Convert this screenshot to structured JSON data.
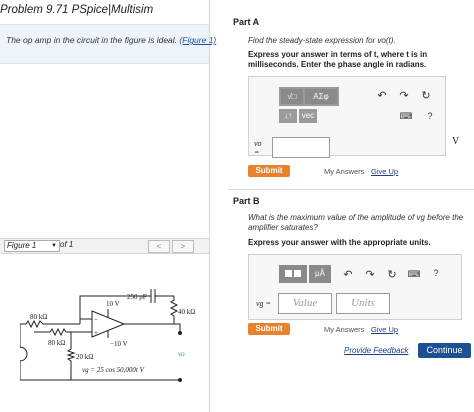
{
  "left": {
    "title": "Problem 9.71 PSpice|Multisim",
    "intro_text": "The op amp in the circuit in the figure is ideal.",
    "intro_link": "(Figure 1)",
    "figure_selector": "Figure 1",
    "figure_of": "of 1",
    "nav_prev": "<",
    "nav_next": ">"
  },
  "circuit": {
    "r1": "80 kΩ",
    "r2": "80 kΩ",
    "r3": "20 kΩ",
    "r4": "40 kΩ",
    "c1": "250 pF",
    "vpos": "10 V",
    "vneg": "−10 V",
    "minus": "−",
    "plus": "+",
    "vg": "vg",
    "vo": "vo",
    "src_plus": "+",
    "src_minus": "−",
    "vg_eq": "vg = 25 cos 50,000t V"
  },
  "partA": {
    "heading": "Part A",
    "question": "Find the steady-state expression for vo(t).",
    "instruction_line1": "Express your answer in terms of t, where t is in",
    "instruction_line2": "milliseconds. Enter the phase angle in radians.",
    "toolbar": {
      "root": "√□",
      "greek": "ΑΣφ",
      "arrows": "↓↑",
      "vec": "vec"
    },
    "var_label": "vo",
    "var_eq": "=",
    "unit": "V",
    "submit": "Submit",
    "my_answers": "My Answers",
    "give_up": "Give Up",
    "help": "?"
  },
  "partB": {
    "heading": "Part B",
    "question_line1": "What is the maximum value of the amplitude of vg before the",
    "question_line2": "amplifier saturates?",
    "instruction": "Express your answer with the appropriate units.",
    "toolbar": {
      "units": "μÅ",
      "help": "?"
    },
    "var_label": "vg =",
    "value_placeholder": "Value",
    "units_placeholder": "Units",
    "submit": "Submit",
    "my_answers": "My Answers",
    "give_up": "Give Up"
  },
  "footer": {
    "provide_feedback": "Provide Feedback",
    "continue": "Continue"
  }
}
